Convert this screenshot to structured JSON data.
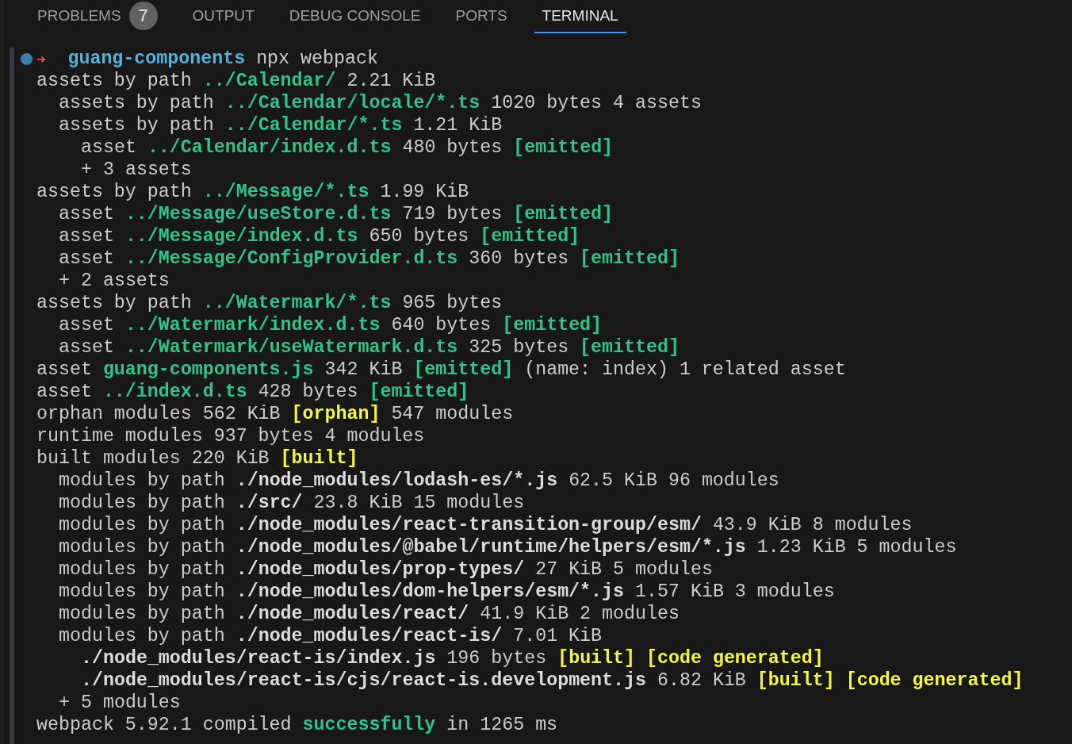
{
  "panel_tabs": [
    {
      "label": "PROBLEMS",
      "badge": "7",
      "selected": false
    },
    {
      "label": "OUTPUT",
      "selected": false
    },
    {
      "label": "DEBUG CONSOLE",
      "selected": false
    },
    {
      "label": "PORTS",
      "selected": false
    },
    {
      "label": "TERMINAL",
      "selected": true
    }
  ],
  "terminal": {
    "prompt": {
      "arrow": "➜",
      "directory": "guang-components",
      "command": "npx webpack"
    },
    "lines": [
      {
        "segments": [
          {
            "text": "assets by path"
          },
          {
            "text": "../Calendar/",
            "kind": "green"
          },
          {
            "text": "2.21 KiB"
          }
        ],
        "children": [
          {
            "segments": [
              {
                "text": "assets by path"
              },
              {
                "text": "../Calendar/locale/*.ts",
                "kind": "green"
              },
              {
                "text": "1020 bytes 4 assets"
              }
            ]
          },
          {
            "segments": [
              {
                "text": "assets by path"
              },
              {
                "text": "../Calendar/*.ts",
                "kind": "green"
              },
              {
                "text": "1.21 KiB"
              }
            ],
            "children": [
              {
                "segments": [
                  {
                    "text": "asset"
                  },
                  {
                    "text": "../Calendar/index.d.ts",
                    "kind": "green"
                  },
                  {
                    "text": "480 bytes"
                  },
                  {
                    "text": "[emitted]",
                    "kind": "green"
                  }
                ]
              },
              {
                "segments": [
                  {
                    "text": "+ 3 assets"
                  }
                ]
              }
            ]
          }
        ]
      },
      {
        "segments": [
          {
            "text": "assets by path"
          },
          {
            "text": "../Message/*.ts",
            "kind": "green"
          },
          {
            "text": "1.99 KiB"
          }
        ],
        "children": [
          {
            "segments": [
              {
                "text": "asset"
              },
              {
                "text": "../Message/useStore.d.ts",
                "kind": "green"
              },
              {
                "text": "719 bytes"
              },
              {
                "text": "[emitted]",
                "kind": "green"
              }
            ]
          },
          {
            "segments": [
              {
                "text": "asset"
              },
              {
                "text": "../Message/index.d.ts",
                "kind": "green"
              },
              {
                "text": "650 bytes"
              },
              {
                "text": "[emitted]",
                "kind": "green"
              }
            ]
          },
          {
            "segments": [
              {
                "text": "asset"
              },
              {
                "text": "../Message/ConfigProvider.d.ts",
                "kind": "green"
              },
              {
                "text": "360 bytes"
              },
              {
                "text": "[emitted]",
                "kind": "green"
              }
            ]
          },
          {
            "segments": [
              {
                "text": "+ 2 assets"
              }
            ]
          }
        ]
      },
      {
        "segments": [
          {
            "text": "assets by path"
          },
          {
            "text": "../Watermark/*.ts",
            "kind": "green"
          },
          {
            "text": "965 bytes"
          }
        ],
        "children": [
          {
            "segments": [
              {
                "text": "asset"
              },
              {
                "text": "../Watermark/index.d.ts",
                "kind": "green"
              },
              {
                "text": "640 bytes"
              },
              {
                "text": "[emitted]",
                "kind": "green"
              }
            ]
          },
          {
            "segments": [
              {
                "text": "asset"
              },
              {
                "text": "../Watermark/useWatermark.d.ts",
                "kind": "green"
              },
              {
                "text": "325 bytes"
              },
              {
                "text": "[emitted]",
                "kind": "green"
              }
            ]
          }
        ]
      },
      {
        "segments": [
          {
            "text": "asset"
          },
          {
            "text": "guang-components.js",
            "kind": "green"
          },
          {
            "text": "342 KiB"
          },
          {
            "text": "[emitted]",
            "kind": "green"
          },
          {
            "text": "(name: index) 1 related asset"
          }
        ]
      },
      {
        "segments": [
          {
            "text": "asset"
          },
          {
            "text": "../index.d.ts",
            "kind": "green"
          },
          {
            "text": "428 bytes"
          },
          {
            "text": "[emitted]",
            "kind": "green"
          }
        ]
      },
      {
        "segments": [
          {
            "text": "orphan modules 562 KiB"
          },
          {
            "text": "[orphan]",
            "kind": "yellow"
          },
          {
            "text": "547 modules"
          }
        ]
      },
      {
        "segments": [
          {
            "text": "runtime modules 937 bytes 4 modules"
          }
        ]
      },
      {
        "segments": [
          {
            "text": "built modules 220 KiB"
          },
          {
            "text": "[built]",
            "kind": "yellow"
          }
        ],
        "children": [
          {
            "segments": [
              {
                "text": "modules by path"
              },
              {
                "text": "./node_modules/lodash-es/*.js",
                "kind": "bold"
              },
              {
                "text": "62.5 KiB 96 modules"
              }
            ]
          },
          {
            "segments": [
              {
                "text": "modules by path"
              },
              {
                "text": "./src/",
                "kind": "bold"
              },
              {
                "text": "23.8 KiB 15 modules"
              }
            ]
          },
          {
            "segments": [
              {
                "text": "modules by path"
              },
              {
                "text": "./node_modules/react-transition-group/esm/",
                "kind": "bold"
              },
              {
                "text": "43.9 KiB 8 modules"
              }
            ]
          },
          {
            "segments": [
              {
                "text": "modules by path"
              },
              {
                "text": "./node_modules/@babel/runtime/helpers/esm/*.js",
                "kind": "bold"
              },
              {
                "text": "1.23 KiB 5 modules"
              }
            ]
          },
          {
            "segments": [
              {
                "text": "modules by path"
              },
              {
                "text": "./node_modules/prop-types/",
                "kind": "bold"
              },
              {
                "text": "27 KiB 5 modules"
              }
            ]
          },
          {
            "segments": [
              {
                "text": "modules by path"
              },
              {
                "text": "./node_modules/dom-helpers/esm/*.js",
                "kind": "bold"
              },
              {
                "text": "1.57 KiB 3 modules"
              }
            ]
          },
          {
            "segments": [
              {
                "text": "modules by path"
              },
              {
                "text": "./node_modules/react/",
                "kind": "bold"
              },
              {
                "text": "41.9 KiB 2 modules"
              }
            ]
          },
          {
            "segments": [
              {
                "text": "modules by path"
              },
              {
                "text": "./node_modules/react-is/",
                "kind": "bold"
              },
              {
                "text": "7.01 KiB"
              }
            ],
            "children": [
              {
                "segments": [
                  {
                    "text": "./node_modules/react-is/index.js",
                    "kind": "bold"
                  },
                  {
                    "text": "196 bytes"
                  },
                  {
                    "text": "[built]",
                    "kind": "yellow"
                  },
                  {
                    "text": "[code generated]",
                    "kind": "yellow"
                  }
                ]
              },
              {
                "segments": [
                  {
                    "text": "./node_modules/react-is/cjs/react-is.development.js",
                    "kind": "bold"
                  },
                  {
                    "text": "6.82 KiB"
                  },
                  {
                    "text": "[built]",
                    "kind": "yellow"
                  },
                  {
                    "text": "[code generated]",
                    "kind": "yellow"
                  }
                ]
              }
            ]
          },
          {
            "segments": [
              {
                "text": "+ 5 modules"
              }
            ]
          }
        ]
      },
      {
        "segments": [
          {
            "text": "webpack 5.92.1 compiled"
          },
          {
            "text": "successfully",
            "kind": "green"
          },
          {
            "text": "in 1265 ms"
          }
        ]
      }
    ]
  }
}
